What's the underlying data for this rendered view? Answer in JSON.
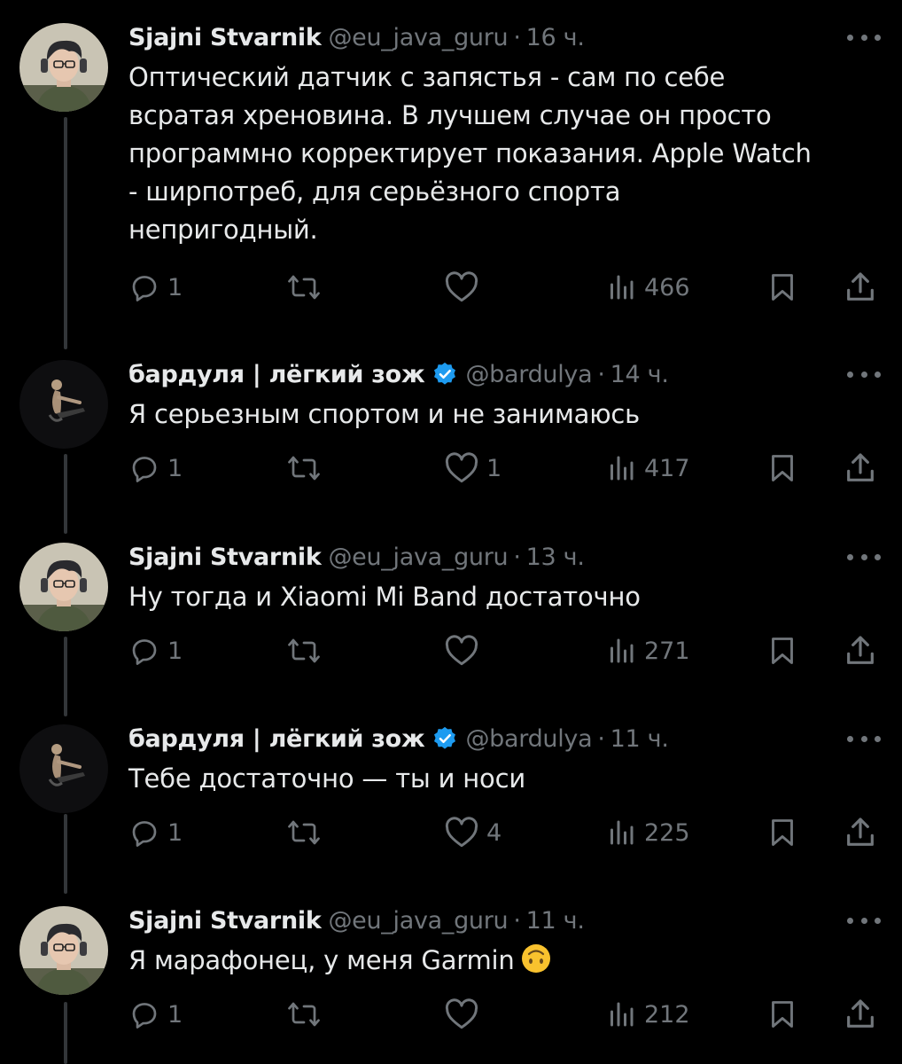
{
  "tweets": [
    {
      "name": "Sjajni Stvarnik",
      "handle": "@eu_java_guru",
      "time": "16 ч.",
      "verified": false,
      "text": "Оптический датчик с запястья - сам по себе\nвсратая хреновина. В лучшем случае он просто\nпрограммно корректирует показания. Apple Watch\n- ширпотреб, для серьёзного спорта\nнепригодный.",
      "replies": "1",
      "reposts": "",
      "likes": "",
      "views": "466"
    },
    {
      "name": "бардуля | лёгкий зож",
      "handle": "@bardulya",
      "time": "14 ч.",
      "verified": true,
      "text": "Я серьезным спортом и не занимаюсь",
      "replies": "1",
      "reposts": "",
      "likes": "1",
      "views": "417"
    },
    {
      "name": "Sjajni Stvarnik",
      "handle": "@eu_java_guru",
      "time": "13 ч.",
      "verified": false,
      "text": "Ну тогда и Xiaomi Mi Band достаточно",
      "replies": "1",
      "reposts": "",
      "likes": "",
      "views": "271"
    },
    {
      "name": "бардуля | лёгкий зож",
      "handle": "@bardulya",
      "time": "11 ч.",
      "verified": true,
      "text": "Тебе достаточно — ты и носи",
      "replies": "1",
      "reposts": "",
      "likes": "4",
      "views": "225"
    },
    {
      "name": "Sjajni Stvarnik",
      "handle": "@eu_java_guru",
      "time": "11 ч.",
      "verified": false,
      "text": "Я марафонец, у меня Garmin",
      "emoji": "upside-down-face-emoji",
      "replies": "1",
      "reposts": "",
      "likes": "",
      "views": "212"
    }
  ],
  "separator": "·",
  "colors": {
    "background": "#000000",
    "text": "#e7e9ea",
    "secondary": "#71767b",
    "verified": "#1d9bf0",
    "thread_line": "#333639"
  },
  "icons": [
    "reply-icon",
    "repost-icon",
    "like-icon",
    "views-icon",
    "bookmark-icon",
    "share-icon",
    "more-icon",
    "verified-badge-icon"
  ]
}
